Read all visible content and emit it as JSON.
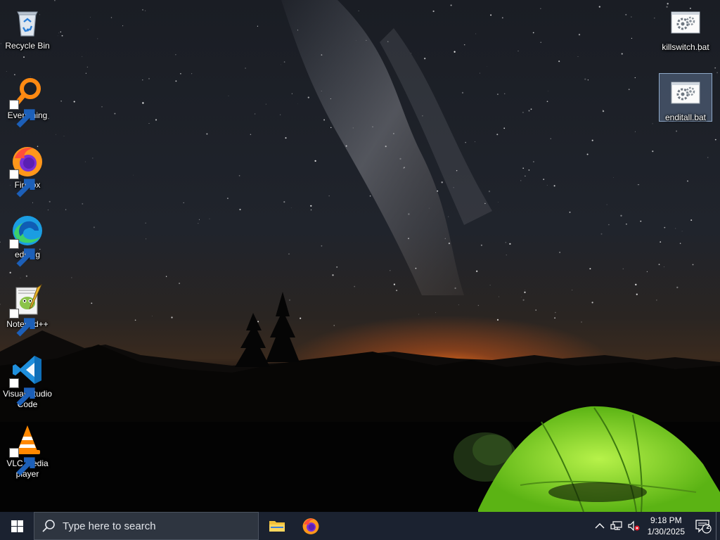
{
  "desktop": {
    "icons_left": [
      {
        "label": "Recycle Bin",
        "icon": "recycle-bin-icon"
      },
      {
        "label": "Everything",
        "icon": "everything-search-icon"
      },
      {
        "label": "Firefox",
        "icon": "firefox-icon"
      },
      {
        "label": "edging",
        "icon": "edge-icon"
      },
      {
        "label": "Notepad++",
        "icon": "notepadpp-icon"
      },
      {
        "label": "Visual Studio Code",
        "icon": "vscode-icon"
      },
      {
        "label": "VLC media player",
        "icon": "vlc-icon"
      }
    ],
    "icons_right": [
      {
        "label": "killswitch.bat",
        "icon": "batch-file-icon"
      },
      {
        "label": "enditall.bat",
        "icon": "batch-file-icon",
        "selected": true
      }
    ]
  },
  "taskbar": {
    "search_placeholder": "Type here to search",
    "pinned": [
      {
        "name": "File Explorer",
        "icon": "folder-icon"
      },
      {
        "name": "Firefox",
        "icon": "firefox-icon"
      }
    ],
    "clock_time": "9:18 PM",
    "clock_date": "1/30/2025",
    "notification_count": "2",
    "colors": {
      "taskbar_bg": "#1b2230",
      "search_bg": "#2e3540",
      "selection": "#7896be"
    }
  }
}
